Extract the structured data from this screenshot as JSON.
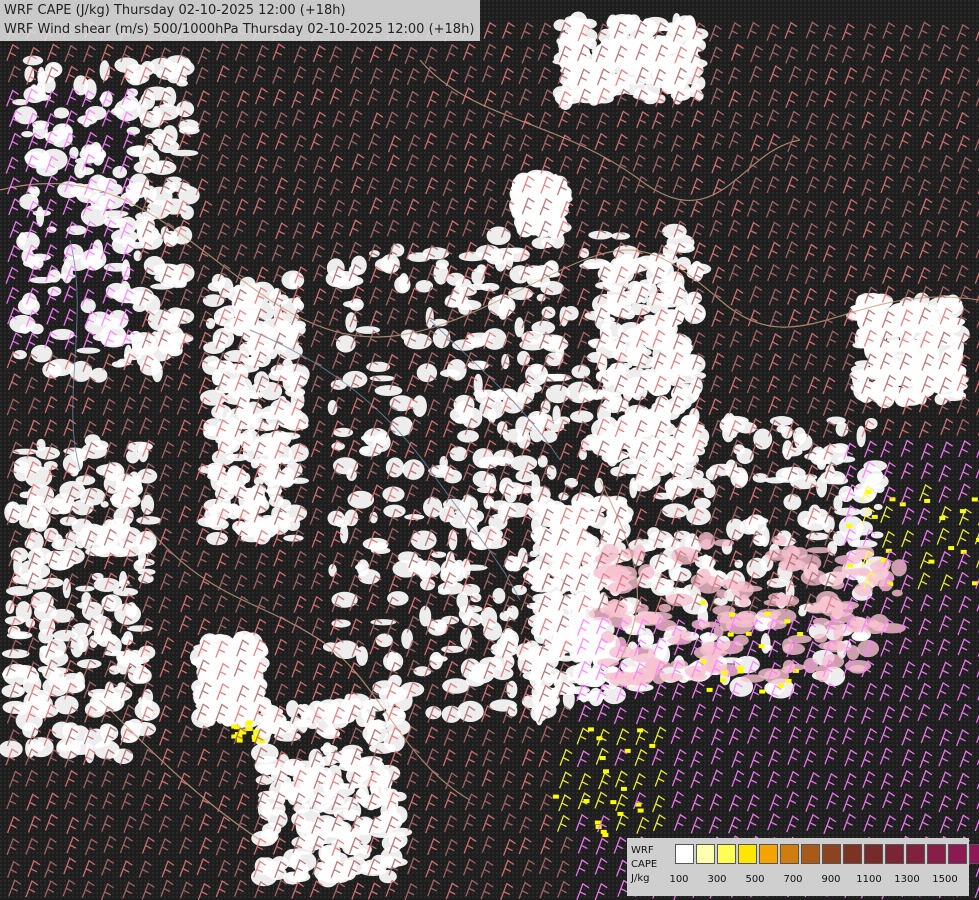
{
  "title": {
    "line1": "WRF CAPE (J/kg) Thursday 02-10-2025 12:00 (+18h)",
    "line2": "WRF Wind shear (m/s) 500/1000hPa Thursday 02-10-2025 12:00 (+18h)"
  },
  "legend": {
    "model": "WRF",
    "field": "CAPE",
    "unit": "J/kg",
    "colors": [
      "#ffffff",
      "#ffffb0",
      "#ffff55",
      "#ffe600",
      "#f5a300",
      "#d07d10",
      "#a85a18",
      "#8c4420",
      "#7c3322",
      "#762a2a",
      "#7a2535",
      "#80223e",
      "#861e48",
      "#8c1a52",
      "#90165a",
      "#94125e"
    ],
    "ticks": [
      "100",
      "300",
      "500",
      "700",
      "900",
      "1100",
      "1300",
      "1500"
    ]
  },
  "map_data": {
    "background": "#1c1c1c",
    "cape_colors": {
      "low": "#ffffff",
      "mid": "#ffff00",
      "high": "#dd00dd"
    },
    "shear_barb_colors": [
      "#b06a6a",
      "#e07878",
      "#ff80ff",
      "#ffff40"
    ],
    "border_color": "#c8a080",
    "river_color": "#6a88aa"
  }
}
